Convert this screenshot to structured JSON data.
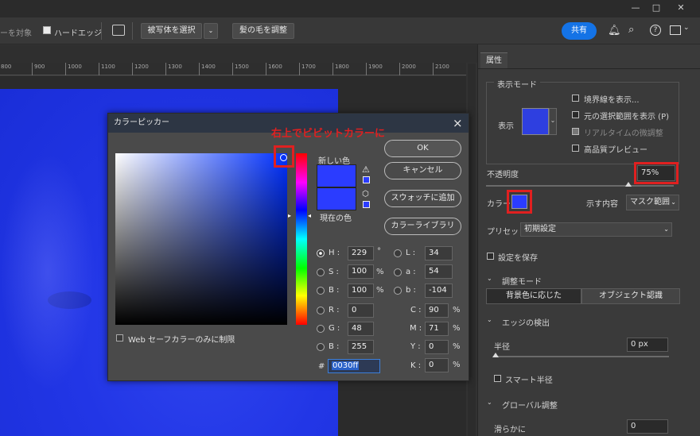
{
  "window": {
    "minimize": "—",
    "maximize": "□",
    "close": "✕"
  },
  "options_bar": {
    "item1": "ーを対象",
    "hard_edge_label": "ハードエッジ",
    "select_subject_label": "被写体を選択",
    "refine_hair_label": "髪の毛を調整",
    "share_label": "共有"
  },
  "ruler": {
    "ticks": [
      "800",
      "900",
      "1000",
      "1100",
      "1200",
      "1300",
      "1400",
      "1500",
      "1600",
      "1700",
      "1800",
      "1900",
      "2000",
      "2100"
    ]
  },
  "annotation": {
    "text": "右上でビビットカラーに"
  },
  "panel": {
    "tab_label": "属性",
    "view_mode_header": "表示モード",
    "view_label": "表示",
    "show_edge": "境界線を表示...",
    "show_original": "元の選択範囲を表示 (P)",
    "realtime": "リアルタイムの微調整",
    "high_quality": "高品質プレビュー",
    "opacity_label": "不透明度",
    "opacity_value": "75%",
    "color_label": "カラー",
    "color_value": "#2b3cff",
    "show_label": "示す内容",
    "mask_range": "マスク範囲",
    "preset_label": "プリセット",
    "preset_value": "初期設定",
    "save_settings": "設定を保存",
    "adjust_mode": "調整モード",
    "mode_bg": "背景色に応じた",
    "mode_object": "オブジェクト認識",
    "edge_detect": "エッジの検出",
    "radius_label": "半径",
    "radius_value": "0 px",
    "smart_radius": "スマート半径",
    "global_adjust": "グローバル調整",
    "smooth_label": "滑らかに",
    "smooth_value": "0"
  },
  "dialog": {
    "title": "カラーピッカー",
    "close": "×",
    "new_color_label": "新しい色",
    "current_color_label": "現在の色",
    "new_color": "#2b3cff",
    "current_color": "#2b3cff",
    "ok": "OK",
    "cancel": "キャンセル",
    "add_swatch": "スウォッチに追加",
    "color_libraries": "カラーライブラリ",
    "web_only": "Web セーフカラーのみに制限",
    "fields": {
      "H": "229",
      "S": "100",
      "B": "100",
      "R": "0",
      "G": "48",
      "Bb": "255",
      "L": "34",
      "a": "54",
      "b": "-104",
      "C": "90",
      "M": "71",
      "Y": "0",
      "K": "0"
    },
    "labels": {
      "H": "H :",
      "S": "S :",
      "B": "B :",
      "R": "R :",
      "G": "G :",
      "Bb": "B :",
      "L": "L :",
      "a": "a :",
      "b": "b :",
      "C": "C :",
      "M": "M :",
      "Y": "Y :",
      "K": "K :",
      "hash": "#"
    },
    "units": {
      "deg": "°",
      "pct": "%"
    },
    "hex": "0030ff"
  }
}
